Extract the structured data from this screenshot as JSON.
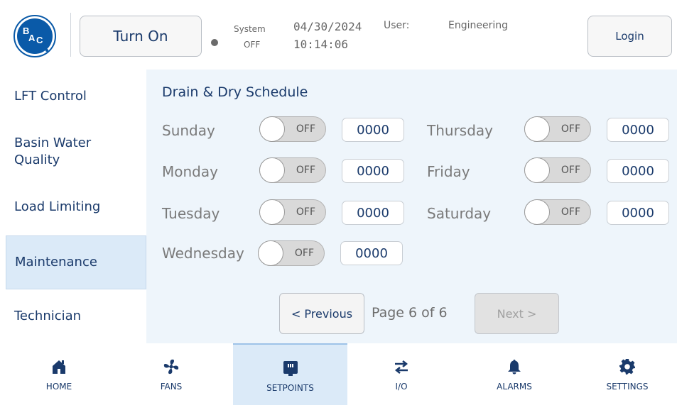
{
  "header": {
    "logo_text": "BAC",
    "turn_on_label": "Turn On",
    "system_label": "System",
    "system_status": "OFF",
    "date": "04/30/2024",
    "time": "10:14:06",
    "user_label": "User:",
    "user_value": "Engineering",
    "login_label": "Login"
  },
  "sidebar": {
    "items": [
      {
        "label": "LFT Control"
      },
      {
        "label": "Basin Water Quality"
      },
      {
        "label": "Load Limiting"
      },
      {
        "label": "Maintenance"
      },
      {
        "label": "Technician"
      }
    ]
  },
  "main": {
    "title": "Drain & Dry Schedule",
    "days": [
      {
        "label": "Sunday",
        "toggle": "OFF",
        "value": "0000"
      },
      {
        "label": "Monday",
        "toggle": "OFF",
        "value": "0000"
      },
      {
        "label": "Tuesday",
        "toggle": "OFF",
        "value": "0000"
      },
      {
        "label": "Wednesday",
        "toggle": "OFF",
        "value": "0000"
      },
      {
        "label": "Thursday",
        "toggle": "OFF",
        "value": "0000"
      },
      {
        "label": "Friday",
        "toggle": "OFF",
        "value": "0000"
      },
      {
        "label": "Saturday",
        "toggle": "OFF",
        "value": "0000"
      }
    ],
    "prev_label": "< Previous",
    "page_indicator": "Page 6 of 6",
    "next_label": "Next >"
  },
  "nav": {
    "items": [
      {
        "label": "HOME",
        "icon": "home-icon"
      },
      {
        "label": "FANS",
        "icon": "fan-icon"
      },
      {
        "label": "SETPOINTS",
        "icon": "setpoints-icon"
      },
      {
        "label": "I/O",
        "icon": "io-arrows-icon"
      },
      {
        "label": "ALARMS",
        "icon": "bell-icon"
      },
      {
        "label": "SETTINGS",
        "icon": "gear-icon"
      }
    ]
  },
  "colors": {
    "brand_blue": "#0a5aa8",
    "text_navy": "#1a3a6b",
    "panel_bg": "#eef5fb",
    "active_bg": "#dbeaf8"
  }
}
